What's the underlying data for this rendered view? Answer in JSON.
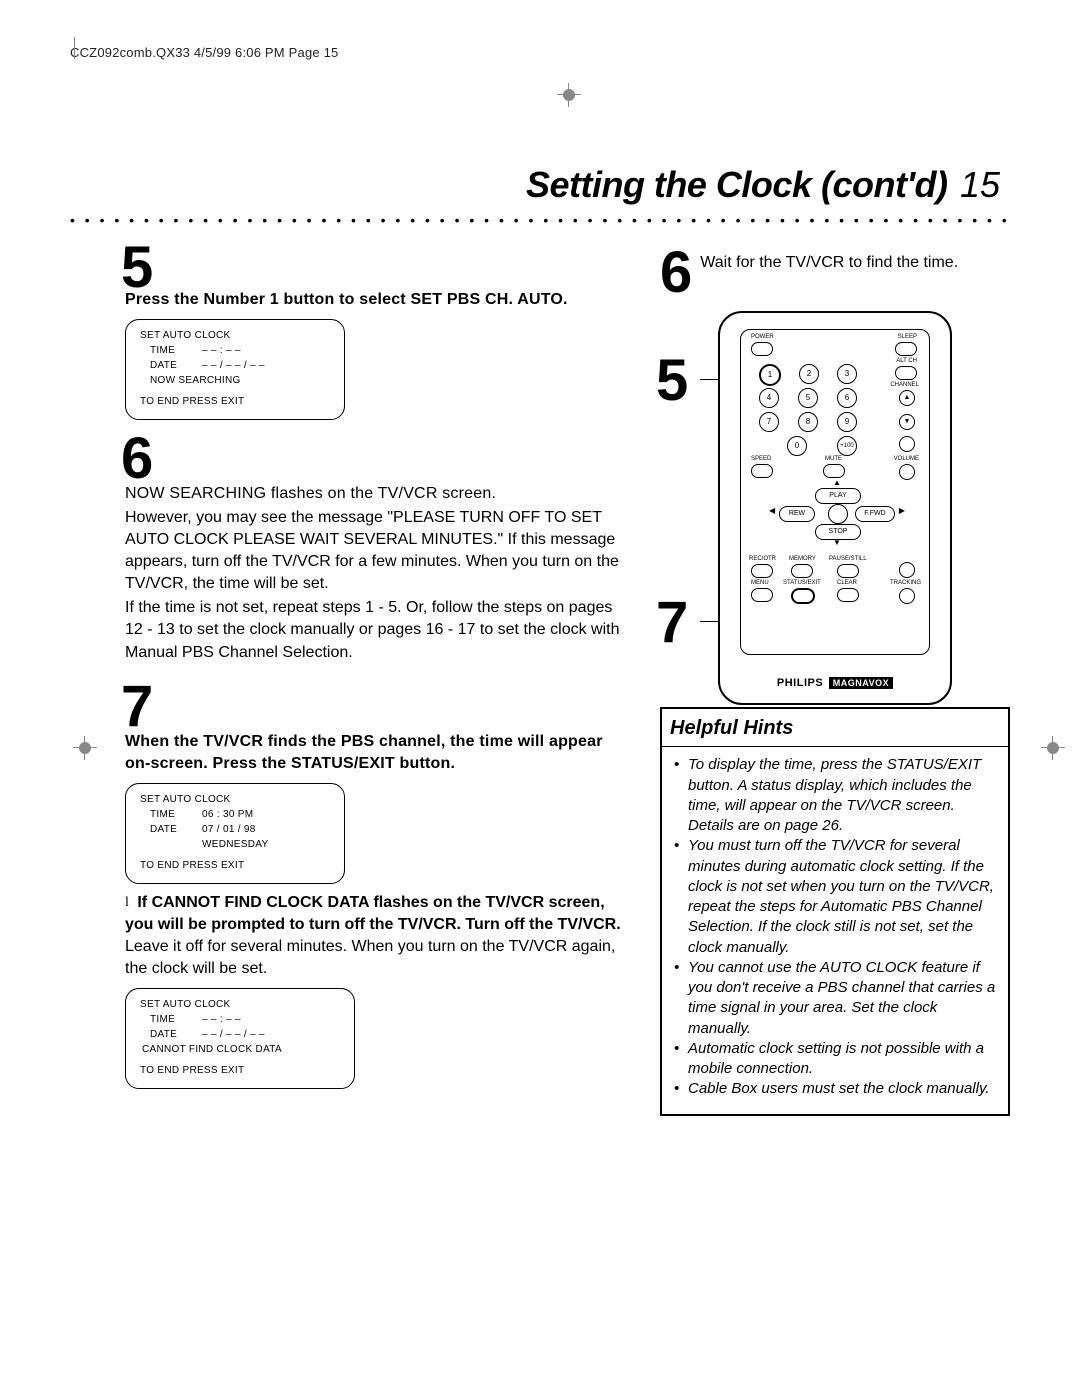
{
  "header": "CCZ092comb.QX33  4/5/99  6:06 PM  Page 15",
  "title": {
    "main": "Setting the Clock (cont'd)",
    "num": "15"
  },
  "left_column": {
    "step5": {
      "num": "5",
      "text": "Press the Number 1 button to select SET PBS CH. AUTO."
    },
    "osd1": {
      "title": "SET AUTO CLOCK",
      "time_label": "TIME",
      "time_val": "– – : – –",
      "date_label": "DATE",
      "date_val": "– – / – – / – –",
      "status": "NOW SEARCHING",
      "footer": "TO END PRESS EXIT"
    },
    "step6": {
      "num": "6",
      "line1": "NOW SEARCHING flashes on the TV/VCR screen.",
      "body1": "However, you may see the message \"PLEASE TURN OFF TO SET AUTO CLOCK PLEASE WAIT SEVERAL MINUTES.\" If this message appears, turn off the TV/VCR for a few minutes. When you turn on the TV/VCR, the time will be set.",
      "body2": "If the time is not set, repeat steps 1 - 5. Or, follow the steps on pages 12 - 13 to set the clock manually or pages 16 - 17 to set the clock with Manual PBS Channel Selection."
    },
    "step7": {
      "num": "7",
      "text": "When the TV/VCR finds the PBS channel, the time will appear on-screen. Press the STATUS/EXIT button."
    },
    "osd2": {
      "title": "SET AUTO CLOCK",
      "time_label": "TIME",
      "time_val": "06 : 30 PM",
      "date_label": "DATE",
      "date_val": "07 / 01 / 98",
      "day": "WEDNESDAY",
      "footer": "TO END PRESS EXIT"
    },
    "note": {
      "bold": "If CANNOT FIND CLOCK DATA flashes on the TV/VCR screen, you will be prompted to turn off the TV/VCR. Turn off the TV/VCR.",
      "rest": " Leave it off for several minutes. When you turn on the TV/VCR again, the clock will be set."
    },
    "osd3": {
      "title": "SET AUTO CLOCK",
      "time_label": "TIME",
      "time_val": "– – : – –",
      "date_label": "DATE",
      "date_val": "– – / – – / – –",
      "status": "CANNOT FIND CLOCK DATA",
      "footer": "TO END PRESS EXIT"
    }
  },
  "right_column": {
    "step6": {
      "num": "6",
      "text": "Wait for the TV/VCR to find the time."
    },
    "callout5": "5",
    "callout7": "7",
    "remote": {
      "labels": {
        "power": "POWER",
        "sleep": "SLEEP",
        "altch": "ALT CH",
        "channel": "CHANNEL",
        "o_btn": "o",
        "up": "▲",
        "down": "▼",
        "plus100": "+100",
        "zero": "0",
        "speed": "SPEED",
        "mute": "MUTE",
        "volume": "VOLUME",
        "play": "PLAY",
        "rew": "REW",
        "ffwd": "F.FWD",
        "stop": "STOP",
        "recotr": "REC/OTR",
        "memory": "MEMORY",
        "pausestill": "PAUSE/STILL",
        "menu": "MENU",
        "statusexit": "STATUS/EXIT",
        "clear": "CLEAR",
        "tracking": "TRACKING"
      },
      "numbers": [
        "1",
        "2",
        "3",
        "4",
        "5",
        "6",
        "7",
        "8",
        "9"
      ],
      "brand1": "PHILIPS",
      "brand2": "MAGNAVOX"
    }
  },
  "hints": {
    "title": "Helpful Hints",
    "items": [
      "To display the time, press the STATUS/EXIT button. A status display, which includes the time, will appear on the TV/VCR screen. Details are on page 26.",
      "You must turn off the TV/VCR for several minutes during automatic clock setting. If the clock is not set when you turn on the TV/VCR, repeat the steps for Automatic PBS Channel Selection. If the clock still is not set, set the clock manually.",
      "You cannot use the AUTO CLOCK feature if you don't receive a PBS channel that carries a time signal in your area. Set the clock manually.",
      "Automatic clock setting is not possible with a mobile connection.",
      "Cable Box users must set the clock manually."
    ]
  }
}
